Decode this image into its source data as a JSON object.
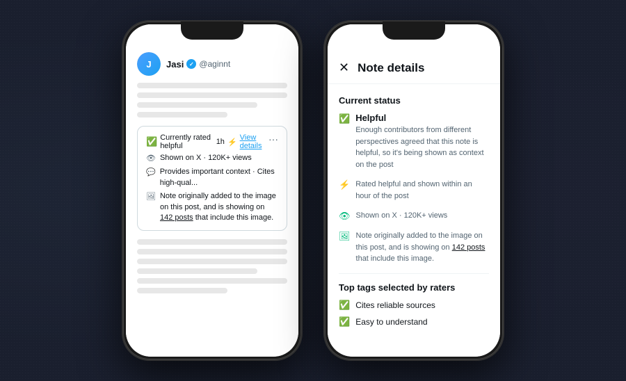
{
  "phone1": {
    "label": "tweet-view-phone",
    "user": {
      "name": "Jasi",
      "handle": "@aginnt",
      "verified": true
    },
    "tweet_lines": [
      {
        "width": "100%"
      },
      {
        "width": "95%"
      },
      {
        "width": "85%"
      },
      {
        "width": "70%"
      }
    ],
    "notes_banner": {
      "row1_label": "Currently rated helpful",
      "row1_time": "1h",
      "row1_bolt": "⚡",
      "row1_link": "View details",
      "row1_dots": "···",
      "row2_icon": "👁",
      "row2_text": "Shown on X · 120K+ views",
      "row3_icon": "💬",
      "row3_text": "Provides important context · Cites high-qual...",
      "row4_icon": "🖼",
      "row4_text_before": "Note originally added to the image on this post, and is showing on ",
      "row4_link": "142 posts",
      "row4_text_after": " that include this image."
    },
    "bottom_lines": [
      {
        "width": "100%"
      },
      {
        "width": "95%"
      },
      {
        "width": "90%"
      },
      {
        "width": "100%"
      },
      {
        "width": "85%"
      },
      {
        "width": "70%"
      }
    ]
  },
  "phone2": {
    "label": "note-details-phone",
    "header": {
      "close": "✕",
      "title": "Note details"
    },
    "current_status_label": "Current status",
    "helpful": {
      "label": "Helpful",
      "description": "Enough contributors from different perspectives agreed that this note is helpful, so it's being shown as context on the post"
    },
    "rated_helpful": {
      "icon": "⚡",
      "text": "Rated helpful and shown within an hour of the post"
    },
    "shown_on_x": {
      "icon": "👁",
      "text": "Shown on X · 120K+ views"
    },
    "image_note": {
      "icon": "🖼",
      "text_before": "Note originally added to the image on this post, and is showing on ",
      "link": "142 posts",
      "text_after": " that include this image."
    },
    "top_tags_label": "Top tags selected by raters",
    "tags": [
      {
        "text": "Cites reliable sources"
      },
      {
        "text": "Easy to understand"
      }
    ]
  }
}
